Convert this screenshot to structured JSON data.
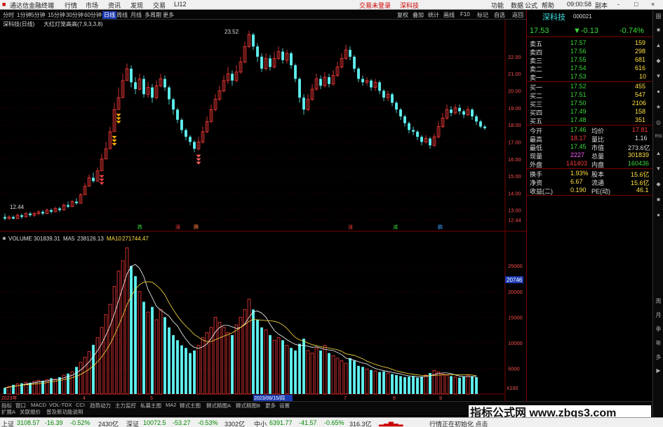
{
  "app": {
    "title": "通达信金融终端",
    "menus": [
      "行情",
      "市场",
      "资讯",
      "发现",
      "交易",
      "LI12"
    ],
    "center_links": [
      "交易未登录",
      "深科技"
    ],
    "right_menus": [
      "功能",
      "数据",
      "公式",
      "帮助"
    ],
    "time": "09:00:58",
    "window_controls": [
      "副本",
      "-",
      "□",
      "×"
    ]
  },
  "toolbar": {
    "periods": [
      "分时",
      "1分钟",
      "5分钟",
      "15分钟",
      "30分钟",
      "60分钟",
      "日线",
      "周线",
      "月线",
      "多周期",
      "更多"
    ],
    "active_period": "日线",
    "tools": [
      "复权",
      "叠加",
      "统计",
      "画线",
      "F10",
      "标记",
      "自选",
      "返回"
    ]
  },
  "chart_header": {
    "label": "深科技(日线)",
    "indicator": "大红灯笼高高(7,9,3,3,8)"
  },
  "annotations": {
    "high_label": "23.52",
    "low_label": "12.44"
  },
  "chart_data": [
    {
      "type": "candlestick",
      "ylim": [
        12.0,
        23.6
      ],
      "y_ticks": [
        12.44,
        13.0,
        14.0,
        15.0,
        16.0,
        17.0,
        18.0,
        19.0,
        20.0,
        21.0,
        22.0
      ],
      "candles": [
        [
          12.6,
          12.5,
          12.8,
          12.4
        ],
        [
          12.5,
          12.6,
          12.7,
          12.44
        ],
        [
          12.6,
          12.5,
          12.7,
          12.45
        ],
        [
          12.5,
          12.7,
          12.8,
          12.5
        ],
        [
          12.7,
          12.6,
          12.8,
          12.5
        ],
        [
          12.6,
          12.8,
          12.9,
          12.6
        ],
        [
          12.8,
          12.7,
          12.9,
          12.6
        ],
        [
          12.7,
          12.8,
          12.9,
          12.6
        ],
        [
          12.8,
          12.9,
          13.0,
          12.7
        ],
        [
          12.9,
          12.8,
          13.0,
          12.7
        ],
        [
          12.8,
          13.0,
          13.1,
          12.8
        ],
        [
          13.0,
          12.9,
          13.1,
          12.8
        ],
        [
          12.9,
          13.1,
          13.2,
          12.9
        ],
        [
          13.1,
          13.0,
          13.2,
          12.9
        ],
        [
          13.0,
          13.3,
          13.4,
          13.0
        ],
        [
          13.3,
          13.2,
          13.5,
          13.1
        ],
        [
          13.2,
          13.5,
          13.6,
          13.2
        ],
        [
          13.5,
          13.4,
          13.7,
          13.3
        ],
        [
          13.4,
          13.9,
          14.0,
          13.4
        ],
        [
          13.9,
          14.4,
          14.6,
          13.9
        ],
        [
          14.4,
          14.9,
          15.1,
          14.4
        ],
        [
          14.9,
          14.7,
          15.2,
          14.6
        ],
        [
          14.7,
          15.3,
          15.5,
          14.7
        ],
        [
          15.3,
          16.0,
          16.3,
          15.3
        ],
        [
          16.0,
          16.6,
          17.0,
          16.0
        ],
        [
          16.6,
          17.6,
          17.9,
          16.6
        ],
        [
          17.6,
          18.9,
          19.3,
          17.6
        ],
        [
          18.9,
          19.6,
          20.2,
          18.9
        ],
        [
          19.6,
          20.6,
          21.0,
          19.6
        ],
        [
          20.6,
          21.3,
          21.6,
          20.6
        ],
        [
          21.3,
          20.5,
          21.5,
          20.2
        ],
        [
          20.5,
          20.1,
          20.8,
          19.8
        ],
        [
          20.1,
          20.7,
          21.0,
          20.0
        ],
        [
          20.7,
          19.8,
          20.9,
          19.6
        ],
        [
          19.8,
          20.2,
          20.5,
          19.6
        ],
        [
          20.2,
          19.6,
          20.4,
          19.3
        ],
        [
          19.6,
          20.3,
          20.6,
          19.5
        ],
        [
          20.3,
          20.7,
          21.0,
          20.2
        ],
        [
          20.7,
          20.2,
          20.9,
          20.0
        ],
        [
          20.2,
          19.5,
          20.3,
          19.2
        ],
        [
          19.5,
          18.9,
          19.6,
          18.6
        ],
        [
          18.9,
          18.3,
          19.0,
          18.1
        ],
        [
          18.3,
          17.7,
          18.4,
          17.5
        ],
        [
          17.7,
          17.3,
          17.8,
          17.1
        ],
        [
          17.3,
          17.0,
          17.4,
          16.8
        ],
        [
          17.0,
          16.6,
          17.1,
          16.4
        ],
        [
          16.6,
          17.0,
          17.3,
          16.5
        ],
        [
          17.0,
          17.6,
          17.9,
          16.9
        ],
        [
          17.6,
          18.2,
          18.5,
          17.5
        ],
        [
          18.2,
          18.9,
          19.2,
          18.1
        ],
        [
          18.9,
          19.5,
          19.8,
          18.8
        ],
        [
          19.5,
          20.0,
          20.3,
          19.4
        ],
        [
          20.0,
          20.6,
          20.9,
          19.9
        ],
        [
          20.6,
          21.0,
          21.4,
          20.4
        ],
        [
          21.0,
          20.6,
          21.2,
          20.3
        ],
        [
          20.6,
          21.1,
          21.5,
          20.5
        ],
        [
          21.1,
          21.7,
          22.0,
          21.0
        ],
        [
          21.7,
          22.6,
          22.9,
          21.6
        ],
        [
          22.6,
          23.3,
          23.52,
          22.5
        ],
        [
          23.3,
          22.6,
          23.4,
          22.4
        ],
        [
          22.6,
          22.0,
          22.8,
          21.7
        ],
        [
          22.0,
          21.3,
          22.2,
          21.1
        ],
        [
          21.3,
          21.9,
          22.2,
          21.2
        ],
        [
          21.9,
          21.4,
          22.1,
          21.2
        ],
        [
          21.4,
          21.9,
          22.3,
          21.3
        ],
        [
          21.9,
          22.3,
          22.6,
          21.8
        ],
        [
          22.3,
          21.8,
          22.5,
          21.6
        ],
        [
          21.8,
          22.2,
          22.4,
          21.6
        ],
        [
          22.2,
          21.5,
          22.3,
          21.3
        ],
        [
          21.5,
          20.7,
          21.6,
          20.5
        ],
        [
          20.7,
          19.6,
          20.8,
          19.3
        ],
        [
          19.6,
          18.9,
          19.8,
          18.6
        ],
        [
          18.9,
          19.5,
          19.8,
          18.8
        ],
        [
          19.5,
          20.1,
          20.4,
          19.4
        ],
        [
          20.1,
          20.7,
          21.0,
          20.0
        ],
        [
          20.7,
          20.3,
          20.9,
          20.1
        ],
        [
          20.3,
          20.8,
          21.1,
          20.2
        ],
        [
          20.8,
          20.4,
          21.0,
          20.2
        ],
        [
          20.4,
          20.9,
          21.2,
          20.3
        ],
        [
          20.9,
          21.4,
          21.7,
          20.8
        ],
        [
          21.4,
          21.9,
          22.2,
          21.3
        ],
        [
          21.9,
          22.4,
          22.7,
          21.8
        ],
        [
          22.4,
          22.0,
          22.6,
          21.8
        ],
        [
          22.0,
          21.3,
          22.1,
          21.1
        ],
        [
          21.3,
          20.7,
          21.4,
          20.5
        ],
        [
          20.7,
          20.5,
          20.9,
          20.3
        ],
        [
          20.5,
          20.6,
          20.8,
          20.3
        ],
        [
          20.6,
          20.2,
          20.7,
          20.0
        ],
        [
          20.2,
          20.5,
          20.7,
          20.0
        ],
        [
          20.5,
          20.0,
          20.6,
          19.8
        ],
        [
          20.0,
          19.6,
          20.1,
          19.4
        ],
        [
          19.6,
          19.8,
          20.0,
          19.4
        ],
        [
          19.8,
          19.3,
          19.9,
          19.1
        ],
        [
          19.3,
          18.9,
          19.4,
          18.7
        ],
        [
          18.9,
          18.5,
          19.0,
          18.3
        ],
        [
          18.5,
          18.1,
          18.6,
          17.9
        ],
        [
          18.1,
          17.7,
          18.2,
          17.5
        ],
        [
          17.7,
          17.6,
          17.9,
          17.4
        ],
        [
          17.6,
          17.3,
          17.7,
          17.1
        ],
        [
          17.3,
          17.0,
          17.4,
          16.8
        ],
        [
          17.0,
          17.2,
          17.4,
          16.9
        ],
        [
          17.2,
          16.8,
          17.3,
          16.6
        ],
        [
          16.8,
          17.3,
          17.5,
          16.7
        ],
        [
          17.3,
          17.9,
          18.2,
          17.2
        ],
        [
          17.9,
          18.4,
          18.7,
          17.8
        ],
        [
          18.4,
          18.9,
          19.2,
          18.3
        ],
        [
          18.9,
          18.7,
          19.1,
          18.5
        ],
        [
          18.7,
          19.0,
          19.2,
          18.6
        ],
        [
          19.0,
          18.8,
          19.2,
          18.6
        ],
        [
          18.8,
          18.6,
          18.9,
          18.4
        ],
        [
          18.6,
          18.9,
          19.1,
          18.5
        ],
        [
          18.9,
          18.5,
          19.0,
          18.3
        ],
        [
          18.5,
          18.2,
          18.6,
          18.0
        ],
        [
          18.2,
          17.9,
          18.3,
          17.8
        ],
        [
          17.9,
          17.8,
          18.0,
          17.7
        ]
      ],
      "lamp_tags": [
        "跌",
        "涨",
        "腾",
        "涨",
        "减",
        "鹏"
      ]
    },
    {
      "type": "bar",
      "title": "VOLUME",
      "series": [
        {
          "name": "VOLUME",
          "value_label": "301839.31"
        },
        {
          "name": "MA5",
          "value_label": "238126.13"
        },
        {
          "name": "MA10",
          "value_label": "271744.47"
        }
      ],
      "ylim": [
        0,
        29000
      ],
      "y_ticks": [
        5000,
        10000,
        15000,
        20000,
        25000
      ],
      "y_ticks_label": [
        "5000",
        "10000",
        "15000",
        "20000",
        "25000"
      ],
      "current_label": "20746",
      "unit_label": "X100",
      "x_labels": [
        "2023年",
        "4",
        "5",
        "2023/06/15/四",
        "7",
        "8",
        "9"
      ],
      "values": [
        1200,
        1500,
        1800,
        2000,
        2100,
        2300,
        2200,
        2500,
        2700,
        2600,
        2800,
        3100,
        2900,
        3300,
        3700,
        4000,
        4400,
        5300,
        6200,
        7200,
        8300,
        9600,
        11000,
        13000,
        15500,
        17500,
        21000,
        24000,
        26000,
        28500,
        25000,
        23000,
        20000,
        18000,
        16000,
        17000,
        14500,
        16500,
        15000,
        13000,
        11500,
        10500,
        9500,
        9000,
        8000,
        8500,
        9500,
        11000,
        12000,
        13000,
        15000,
        14000,
        13000,
        12000,
        11500,
        13500,
        15000,
        16500,
        18500,
        16500,
        14500,
        13000,
        12500,
        11500,
        10500,
        11000,
        10500,
        9500,
        9000,
        8500,
        9800,
        10800,
        8500,
        8000,
        9000,
        8500,
        9500,
        8000,
        7500,
        7000,
        6500,
        6000,
        7000,
        6500,
        5500,
        5300,
        4900,
        4700,
        4500,
        4300,
        4400,
        4100,
        3900,
        3700,
        3500,
        3300,
        3400,
        3500,
        3200,
        3400,
        3700,
        4100,
        4600,
        4300,
        3900,
        3700,
        3500,
        3300,
        3200,
        3400,
        3700,
        3500,
        3300
      ]
    }
  ],
  "quote": {
    "name": "深科技",
    "code": "000021",
    "price": "17.53",
    "change": "▼-0.13",
    "change_pct": "-0.74%",
    "asks": [
      {
        "label": "卖五",
        "price": "17.57",
        "vol": "159"
      },
      {
        "label": "卖四",
        "price": "17.56",
        "vol": "298"
      },
      {
        "label": "卖三",
        "price": "17.55",
        "vol": "681"
      },
      {
        "label": "卖二",
        "price": "17.54",
        "vol": "616"
      },
      {
        "label": "卖一",
        "price": "17.53",
        "vol": "10"
      }
    ],
    "bids": [
      {
        "label": "买一",
        "price": "17.52",
        "vol": "455"
      },
      {
        "label": "买二",
        "price": "17.51",
        "vol": "547"
      },
      {
        "label": "买三",
        "price": "17.50",
        "vol": "2106"
      },
      {
        "label": "买四",
        "price": "17.49",
        "vol": "158"
      },
      {
        "label": "买五",
        "price": "17.48",
        "vol": "351"
      }
    ],
    "stats": [
      {
        "l1": "今开",
        "v1": "17.46",
        "l2": "均价",
        "v2": "17.81"
      },
      {
        "l1": "最高",
        "v1": "18.17",
        "l2": "量比",
        "v2": "1.16"
      },
      {
        "l1": "最低",
        "v1": "17.45",
        "l2": "市值",
        "v2": "273.6亿"
      },
      {
        "l1": "现量",
        "v1": "2227",
        "l2": "总量",
        "v2": "301839"
      },
      {
        "l1": "外盘",
        "v1": "141403",
        "l2": "内盘",
        "v2": "160436"
      }
    ],
    "stats2": [
      {
        "l1": "换手",
        "v1": "1.93%",
        "l2": "股本",
        "v2": "15.6亿"
      },
      {
        "l1": "净资",
        "v1": "6.67",
        "l2": "流通",
        "v2": "15.6亿"
      },
      {
        "l1": "收益(二)",
        "v1": "0.190",
        "l2": "PE(动)",
        "v2": "46.1"
      }
    ]
  },
  "side_icons": [
    "圖",
    "■",
    "▲",
    "◆",
    "▼",
    "●",
    "★",
    "◎",
    "RSI",
    "▲",
    "▼",
    "◆",
    "■",
    "●",
    "周",
    "月",
    "季",
    "年",
    "多",
    "▶"
  ],
  "indicator_tabs": [
    "指标",
    "窗口",
    "MACD",
    "VOL-TDX",
    "CCI",
    "趋势动力",
    "主力监控",
    "私募主图",
    "MA2",
    "狮式主图",
    "狮式精图A",
    "狮式精图B",
    "更多",
    "设置"
  ],
  "indicator_tabs2": [
    "扩展A",
    "关联报价",
    "普及新功能说明"
  ],
  "statusbar": {
    "items": [
      {
        "name": "上证",
        "val": "3108.57",
        "chg": "-16.39",
        "pct": "-0.52%",
        "amt": "2430亿"
      },
      {
        "name": "深证",
        "val": "10072.5",
        "chg": "-53.27",
        "pct": "-0.53%",
        "amt": "3302亿"
      },
      {
        "name": "中小",
        "val": "6391.77",
        "chg": "-41.57",
        "pct": "-0.65%",
        "amt": "316.3亿"
      }
    ],
    "msg": "行情正在初始化 点击"
  },
  "watermark": "指标公式网 www.zbgs3.com"
}
